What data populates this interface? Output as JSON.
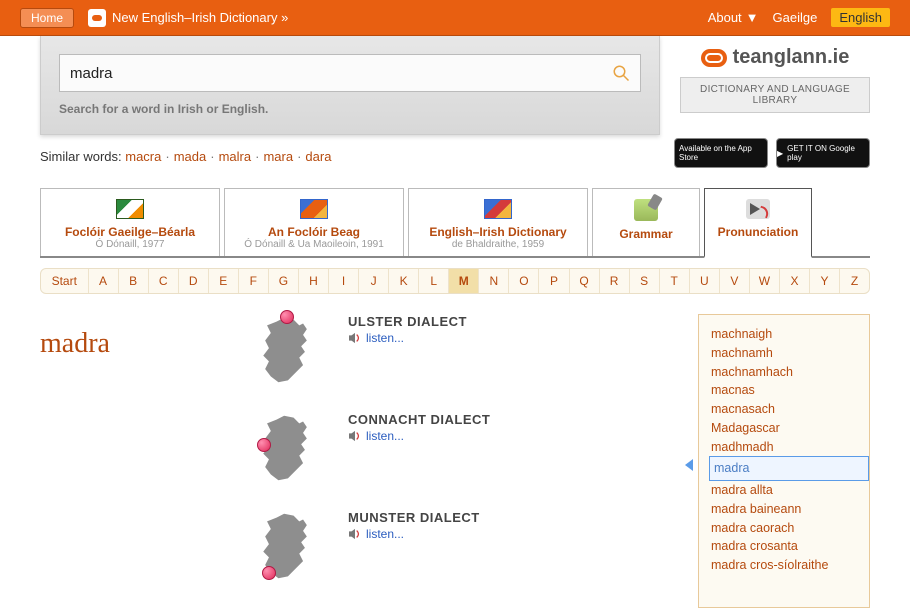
{
  "topbar": {
    "home": "Home",
    "nei_link": "New English–Irish Dictionary »",
    "about": "About",
    "lang_ga": "Gaeilge",
    "lang_en": "English"
  },
  "brand": {
    "name": "teanglann.ie",
    "tagline": "DICTIONARY AND LANGUAGE LIBRARY",
    "appstore": "Available on the App Store",
    "playstore": "GET IT ON Google play"
  },
  "search": {
    "value": "madra",
    "hint": "Search for a word in Irish or English."
  },
  "similar": {
    "label": "Similar words:",
    "items": [
      "macra",
      "mada",
      "malra",
      "mara",
      "dara"
    ]
  },
  "tabs": [
    {
      "title": "Foclóir Gaeilge–Béarla",
      "sub": "Ó Dónaill, 1977"
    },
    {
      "title": "An Foclóir Beag",
      "sub": "Ó Dónaill & Ua Maoileoin, 1991"
    },
    {
      "title": "English–Irish Dictionary",
      "sub": "de Bhaldraithe, 1959"
    },
    {
      "title": "Grammar",
      "sub": ""
    },
    {
      "title": "Pronunciation",
      "sub": ""
    }
  ],
  "alpha": {
    "start": "Start",
    "letters": [
      "A",
      "B",
      "C",
      "D",
      "E",
      "F",
      "G",
      "H",
      "I",
      "J",
      "K",
      "L",
      "M",
      "N",
      "O",
      "P",
      "Q",
      "R",
      "S",
      "T",
      "U",
      "V",
      "W",
      "X",
      "Y",
      "Z"
    ],
    "active": "M"
  },
  "headword": "madra",
  "dialects": [
    {
      "name": "ULSTER DIALECT",
      "listen": "listen..."
    },
    {
      "name": "CONNACHT DIALECT",
      "listen": "listen..."
    },
    {
      "name": "MUNSTER DIALECT",
      "listen": "listen..."
    }
  ],
  "wordlist": [
    "machnaigh",
    "machnamh",
    "machnamhach",
    "macnas",
    "macnasach",
    "Madagascar",
    "madhmadh",
    "madra",
    "madra allta",
    "madra baineann",
    "madra caorach",
    "madra crosanta",
    "madra cros-síolraithe"
  ],
  "wordlist_selected": "madra"
}
